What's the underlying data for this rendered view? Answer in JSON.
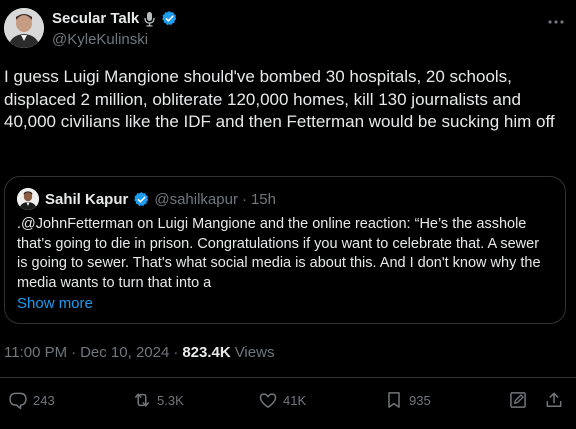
{
  "author": {
    "name": "Secular Talk",
    "handle": "@KyleKulinski"
  },
  "tweet": {
    "text": "I guess Luigi Mangione should've bombed 30 hospitals, 20 schools, displaced 2 million, obliterate 120,000 homes, kill 130 journalists and 40,000 civilians like the IDF and then Fetterman would be sucking him off"
  },
  "quote": {
    "name": "Sahil Kapur",
    "handle": "@sahilkapur",
    "dot": "·",
    "time": "15h",
    "text": ".@JohnFetterman on Luigi Mangione and the online reaction: “He’s the asshole that’s going to die in prison. Congratulations if you want to celebrate that. A sewer is going to sewer. That's what social media is about this. And I don't know why the media wants to turn that into a",
    "show_more": "Show more"
  },
  "meta": {
    "time": "11:00 PM",
    "sep1": "·",
    "date": "Dec 10, 2024",
    "sep2": "·",
    "views_count": "823.4K",
    "views_label": "Views"
  },
  "actions": {
    "replies": "243",
    "reposts": "5.3K",
    "likes": "41K",
    "bookmarks": "935"
  },
  "colors": {
    "background": "#000000",
    "text": "#e7e9ea",
    "muted": "#71767b",
    "accent": "#1d9bf0",
    "border": "#2f3336"
  },
  "icons": [
    "microphone-icon",
    "verified-badge-icon",
    "more-options-icon",
    "reply-icon",
    "repost-icon",
    "like-icon",
    "bookmark-icon",
    "edit-icon",
    "share-icon"
  ]
}
